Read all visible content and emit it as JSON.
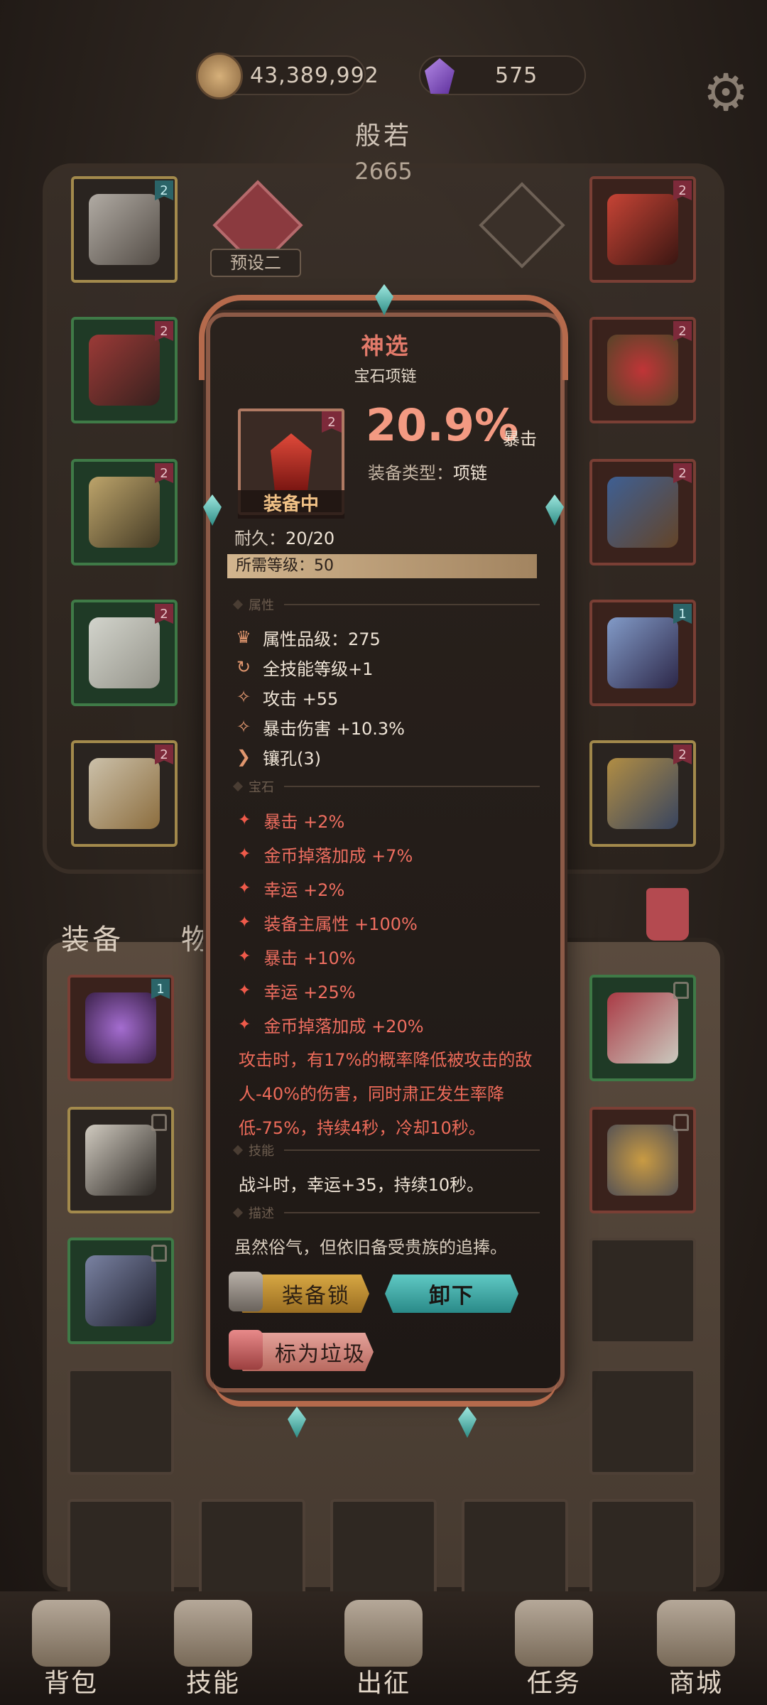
{
  "currency": {
    "gold": "43,389,992",
    "gems": "575"
  },
  "character": {
    "name": "般若",
    "score": "2665",
    "preset": "预设二"
  },
  "tabs": {
    "equipment": "装备",
    "items": "物品"
  },
  "slot_tags": {
    "left": [
      "2",
      "2",
      "2",
      "2",
      "2"
    ],
    "right": [
      "2",
      "2",
      "2",
      "1",
      "2"
    ],
    "inventory_first": "1"
  },
  "item": {
    "name": "神选",
    "type_name": "宝石项链",
    "tier_tag": "2",
    "equipped": "装备中",
    "main_stat_value": "20.9%",
    "main_stat_label": "暴击",
    "equip_type_label": "装备类型：",
    "equip_type": "项链",
    "durability_label": "耐久：",
    "durability": "20/20",
    "required_level_label": "所需等级：",
    "required_level": "50",
    "sections": {
      "attributes": "属性",
      "gems": "宝石",
      "skill": "技能",
      "description": "描述"
    },
    "attributes": [
      {
        "icon": "quality-icon",
        "glyph": "♛",
        "text": "属性品级：275"
      },
      {
        "icon": "refresh-icon",
        "glyph": "↻",
        "text": "全技能等级+1"
      },
      {
        "icon": "attack-icon",
        "glyph": "✧",
        "text": "攻击 +55"
      },
      {
        "icon": "crit-damage-icon",
        "glyph": "✧",
        "text": "暴击伤害 +10.3%"
      },
      {
        "icon": "socket-icon",
        "glyph": "❯",
        "text": "镶孔(3)"
      }
    ],
    "gem_stats": [
      "暴击 +2%",
      "金币掉落加成 +7%",
      "幸运 +2%",
      "装备主属性 +100%",
      "暴击 +10%",
      "幸运 +25%",
      "金币掉落加成 +20%"
    ],
    "effect": "攻击时，有17%的概率降低被攻击的敌人-40%的伤害，同时肃正发生率降低-75%，持续4秒，冷却10秒。",
    "skill": "战斗时，幸运+35，持续10秒。",
    "description": "虽然俗气，但依旧备受贵族的追捧。"
  },
  "buttons": {
    "lock": "装备锁",
    "unequip": "卸下",
    "mark_junk": "标为垃圾"
  },
  "nav": [
    {
      "id": "bag",
      "label": "背包"
    },
    {
      "id": "skills",
      "label": "技能"
    },
    {
      "id": "battle",
      "label": "出征"
    },
    {
      "id": "tasks",
      "label": "任务"
    },
    {
      "id": "shop",
      "label": "商城"
    }
  ],
  "colors": {
    "accent_red": "#f39a82",
    "gem_stat": "#ef6e60",
    "unequip_button": "#5fc9c4",
    "lock_button": "#d7a743"
  }
}
